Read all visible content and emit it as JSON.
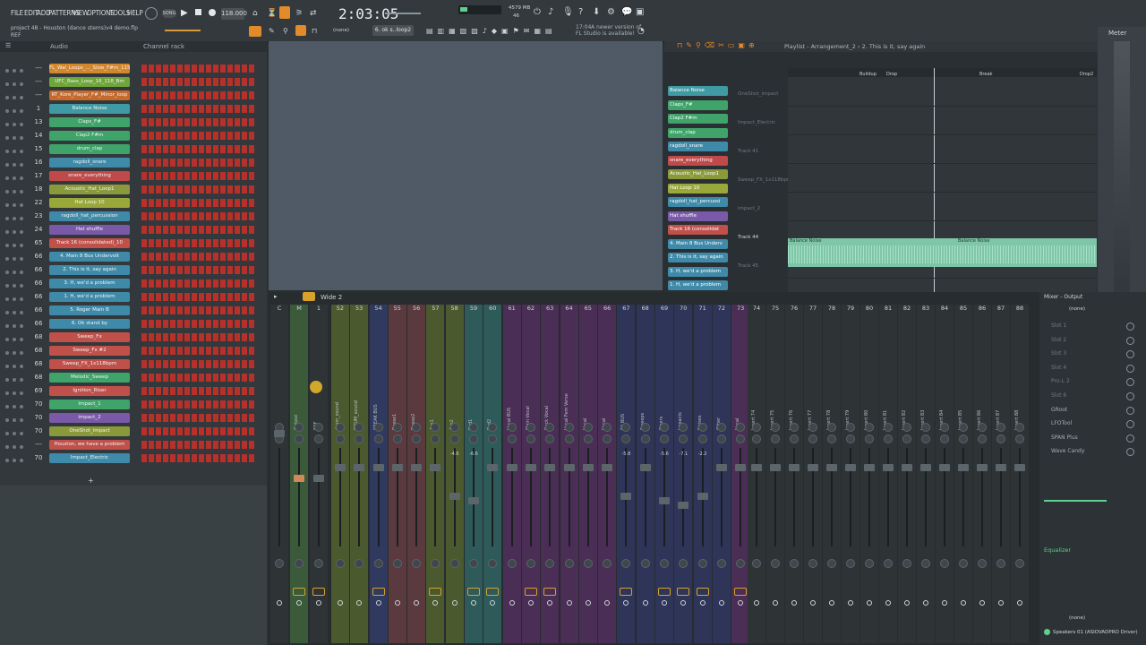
{
  "menu": [
    "FILE",
    "EDIT",
    "ADD",
    "PATTERNS",
    "VIEW",
    "OPTIONS",
    "TOOLS",
    "HELP"
  ],
  "transport": {
    "bpm": "118.000",
    "time": "2:03:05",
    "mode": "SONG",
    "pattern_selector": "6. ok s..loop2",
    "snap": "(none)"
  },
  "project": {
    "title": "project 48 - Houston (dance stems)v4 demo.flp",
    "subtitle": "REF"
  },
  "notice": {
    "time": "17:04",
    "text1": "A newer version of",
    "text2": "FL Studio is available!"
  },
  "cpu": {
    "mem": "4579 MB",
    "polyphony": "46"
  },
  "channel_rack": {
    "header_left": "Audio",
    "header_title": "Channel rack",
    "channels": [
      {
        "num": "---",
        "name": "FL_Wal_Loops_..._Slow_F#m_115",
        "color": "#d4862a"
      },
      {
        "num": "---",
        "name": "UFC_Bass_Loop_16_118_Bm",
        "color": "#6fa63a"
      },
      {
        "num": "---",
        "name": "RT_Kore_Player_F#_Minor_loop",
        "color": "#c56a2a"
      },
      {
        "num": "1",
        "name": "Balance Noise",
        "color": "#3f9aa4"
      },
      {
        "num": "13",
        "name": "Claps_F#",
        "color": "#3fa36a"
      },
      {
        "num": "14",
        "name": "Clap2 F#m",
        "color": "#3fa36a"
      },
      {
        "num": "15",
        "name": "drum_clap",
        "color": "#3fa36a"
      },
      {
        "num": "16",
        "name": "ragdoll_snare",
        "color": "#3f8aa8"
      },
      {
        "num": "17",
        "name": "snare_everything",
        "color": "#c04a4a"
      },
      {
        "num": "18",
        "name": "Acoustic_Hat_Loop1",
        "color": "#8a9a3a"
      },
      {
        "num": "22",
        "name": "Hat Loop 10",
        "color": "#9aa83a"
      },
      {
        "num": "23",
        "name": "ragdoll_hat_percussion",
        "color": "#3f8aa8"
      },
      {
        "num": "24",
        "name": "Hat shuffle",
        "color": "#7a5aa8"
      },
      {
        "num": "65",
        "name": "Track 16 (consolidated)_10",
        "color": "#c0504a"
      },
      {
        "num": "66",
        "name": "4. Main 8 Bus Undervolt",
        "color": "#3f8aa8"
      },
      {
        "num": "66",
        "name": "2. This is it, say again",
        "color": "#3f8aa8"
      },
      {
        "num": "66",
        "name": "3. H, we'd a problem",
        "color": "#3f8aa8"
      },
      {
        "num": "66",
        "name": "1. H, we'd a problem",
        "color": "#3f8aa8"
      },
      {
        "num": "66",
        "name": "5. Roger Main B",
        "color": "#3f8aa8"
      },
      {
        "num": "66",
        "name": "6. Ok stand by",
        "color": "#3f8aa8"
      },
      {
        "num": "68",
        "name": "Sweep_Fx",
        "color": "#c0504a"
      },
      {
        "num": "68",
        "name": "Sweep_Fx #2",
        "color": "#c0504a"
      },
      {
        "num": "68",
        "name": "Sweep_FX_1x118bpm",
        "color": "#c0504a"
      },
      {
        "num": "68",
        "name": "Melodic_Sweep",
        "color": "#3fa36a"
      },
      {
        "num": "69",
        "name": "Ignition_Riser",
        "color": "#c0504a"
      },
      {
        "num": "70",
        "name": "Impact_1",
        "color": "#3fa36a"
      },
      {
        "num": "70",
        "name": "impact_2",
        "color": "#7a5aa8"
      },
      {
        "num": "70",
        "name": "OneShot_impact",
        "color": "#8a9a3a"
      },
      {
        "num": "---",
        "name": "Houston, we have a problem",
        "color": "#c0504a"
      },
      {
        "num": "70",
        "name": "Impact_Electric",
        "color": "#3f8aa8"
      }
    ]
  },
  "playlist": {
    "title": "Playlist - Arrangement_2 › 2. This is it, say again",
    "patterns": [
      {
        "name": "Balance Noise",
        "color": "#3f9aa4"
      },
      {
        "name": "Claps_F#",
        "color": "#3fa36a"
      },
      {
        "name": "Clap2 F#m",
        "color": "#3fa36a"
      },
      {
        "name": "drum_clap",
        "color": "#3fa36a"
      },
      {
        "name": "ragdoll_snare",
        "color": "#3f8aa8"
      },
      {
        "name": "snare_everything",
        "color": "#c04a4a"
      },
      {
        "name": "Acoustic_Hat_Loop1",
        "color": "#8a9a3a"
      },
      {
        "name": "Hat Loop 10",
        "color": "#9aa83a"
      },
      {
        "name": "ragdoll_hat_percussi",
        "color": "#3f8aa8"
      },
      {
        "name": "Hat shuffle",
        "color": "#7a5aa8"
      },
      {
        "name": "Track 16 (consolidat",
        "color": "#c0504a"
      },
      {
        "name": "4. Main 8 Bus Underv",
        "color": "#3f8aa8"
      },
      {
        "name": "2. This is it, say again",
        "color": "#3f8aa8"
      },
      {
        "name": "3. H, we'd a problem",
        "color": "#3f8aa8"
      },
      {
        "name": "1. H, we'd a problem",
        "color": "#3f8aa8"
      }
    ],
    "tracks": [
      "OneShot_impact",
      "Impact_Electric",
      "Track 41",
      "Sweep_FX_1x118bpm",
      "impact_2",
      "Track 44",
      "Track 45"
    ],
    "markers": [
      "Buildup",
      "Drop",
      "Break",
      "Drop2"
    ],
    "clip_label": "Balance Noise"
  },
  "mixer": {
    "title": "Wide 2",
    "strips": [
      {
        "num": "C",
        "name": ""
      },
      {
        "num": "M",
        "name": "Output"
      },
      {
        "num": "1",
        "name": "REF"
      },
      {
        "num": "52",
        "name": "drum_sound"
      },
      {
        "num": "53",
        "name": "DRUM_sound"
      },
      {
        "num": "54",
        "name": "BREAK BUS"
      },
      {
        "num": "55",
        "name": "Reese1"
      },
      {
        "num": "56",
        "name": "Reese2"
      },
      {
        "num": "57",
        "name": "Arp1"
      },
      {
        "num": "58",
        "name": "Arp2"
      },
      {
        "num": "59",
        "name": "Pad1"
      },
      {
        "num": "60",
        "name": "Pad2"
      },
      {
        "num": "61",
        "name": "Vocal BUS"
      },
      {
        "num": "62",
        "name": "Main Vocal"
      },
      {
        "num": "63",
        "name": "Back Vocal"
      },
      {
        "num": "64",
        "name": "Vocal Fem Verse"
      },
      {
        "num": "65",
        "name": "Vocal"
      },
      {
        "num": "66",
        "name": "Vocal"
      },
      {
        "num": "67",
        "name": "FX BUS"
      },
      {
        "num": "68",
        "name": "Sweeps"
      },
      {
        "num": "69",
        "name": "Risers"
      },
      {
        "num": "70",
        "name": "Impacts"
      },
      {
        "num": "71",
        "name": "Noises"
      },
      {
        "num": "72",
        "name": "Other"
      },
      {
        "num": "73",
        "name": "Vocal"
      },
      {
        "num": "74",
        "name": "Insert 74"
      },
      {
        "num": "75",
        "name": "Insert 75"
      },
      {
        "num": "76",
        "name": "Insert 76"
      },
      {
        "num": "77",
        "name": "Insert 77"
      },
      {
        "num": "78",
        "name": "Insert 78"
      },
      {
        "num": "79",
        "name": "Insert 79"
      },
      {
        "num": "80",
        "name": "Insert 80"
      },
      {
        "num": "81",
        "name": "Insert 81"
      },
      {
        "num": "82",
        "name": "Insert 82"
      },
      {
        "num": "83",
        "name": "Insert 83"
      },
      {
        "num": "84",
        "name": "Insert 84"
      },
      {
        "num": "85",
        "name": "Insert 85"
      },
      {
        "num": "86",
        "name": "Insert 86"
      },
      {
        "num": "87",
        "name": "Insert 87"
      },
      {
        "num": "88",
        "name": "Insert 88"
      }
    ],
    "db_values": {
      "9": "-4.6",
      "10": "-6.6",
      "18": "-5.8",
      "20": "-5.6",
      "21": "-7.1",
      "22": "-2.2"
    },
    "scale": [
      "3",
      "6",
      "3",
      "6",
      "9",
      "12",
      "15",
      "18",
      "21",
      "24",
      "27",
      "30"
    ]
  },
  "mixer_output": {
    "title": "Mixer - Output",
    "none_top": "(none)",
    "slots": [
      "Slot 1",
      "Slot 2",
      "Slot 3",
      "Slot 4",
      "Pro-L 2",
      "Slot 6",
      "GRoot",
      "LFOTool",
      "SPAN Plus",
      "Wave Candy"
    ],
    "equalizer": "Equalizer",
    "none_bottom": "(none)",
    "device": "Speakers 01 (ASIOVADPRO Driver)"
  },
  "meter_title": "Meter"
}
